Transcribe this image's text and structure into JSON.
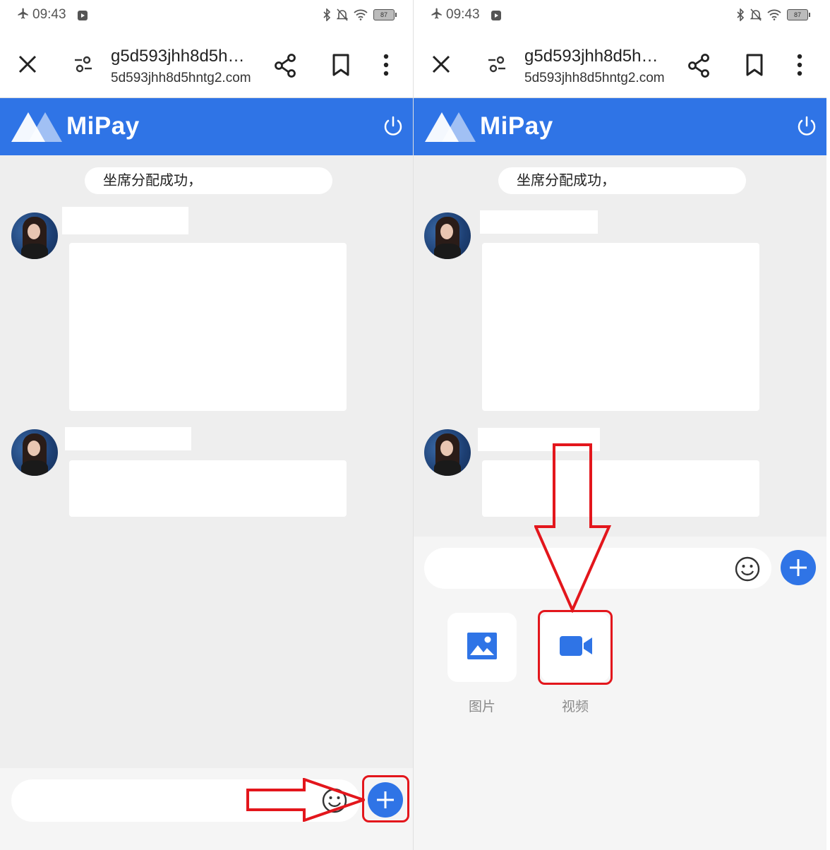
{
  "status_bar": {
    "time": "09:43",
    "battery": "87"
  },
  "browser": {
    "title": "g5d593jhh8d5h…",
    "url": "5d593jhh8d5hntg2.com"
  },
  "app": {
    "brand": "MiPay"
  },
  "chat": {
    "system_message": "坐席分配成功，"
  },
  "toolbar": {
    "items": [
      {
        "label": "图片",
        "icon": "image-icon"
      },
      {
        "label": "视频",
        "icon": "video-camera-icon"
      }
    ]
  },
  "colors": {
    "brand_blue": "#2f74e6",
    "highlight_red": "#e3161c",
    "chat_background": "#eeeeee"
  }
}
